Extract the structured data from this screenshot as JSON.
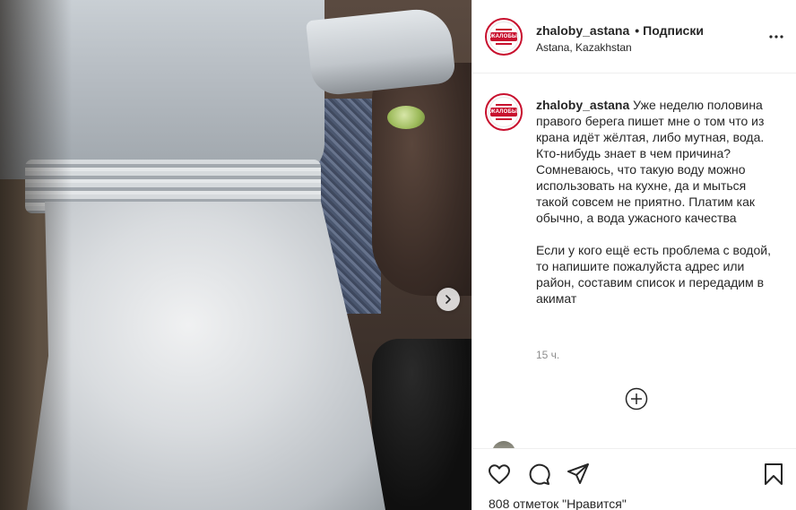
{
  "post": {
    "username": "zhaloby_astana",
    "separator": "•",
    "follow_label": "Подписки",
    "location": "Astana, Kazakhstan",
    "avatar_text": "ЖАЛОБЫ",
    "caption_part1": "Уже неделю половина правого берега пишет мне о том что из крана идёт жёлтая, либо мутная, вода. Кто-нибудь знает в чем причина? Сомневаюсь, что такую воду можно использовать на кухне, да и мыться такой совсем не приятно. Платим как обычно, а вода ужасного качества",
    "caption_part2": "Если у кого ещё есть проблема с водой, то напишите пожалуйста адрес или район, составим список и передадим в акимат",
    "time_ago": "15 ч.",
    "likes_text": "808 отметок \"Нравится\""
  },
  "icons": {
    "more": "more-icon",
    "next": "chevron-right-icon",
    "add": "plus-circle-icon",
    "like": "heart-icon",
    "comment": "comment-icon",
    "share": "paper-plane-icon",
    "save": "bookmark-icon"
  },
  "colors": {
    "brand_red": "#c8102e",
    "text": "#262626",
    "muted": "#8e8e8e"
  }
}
